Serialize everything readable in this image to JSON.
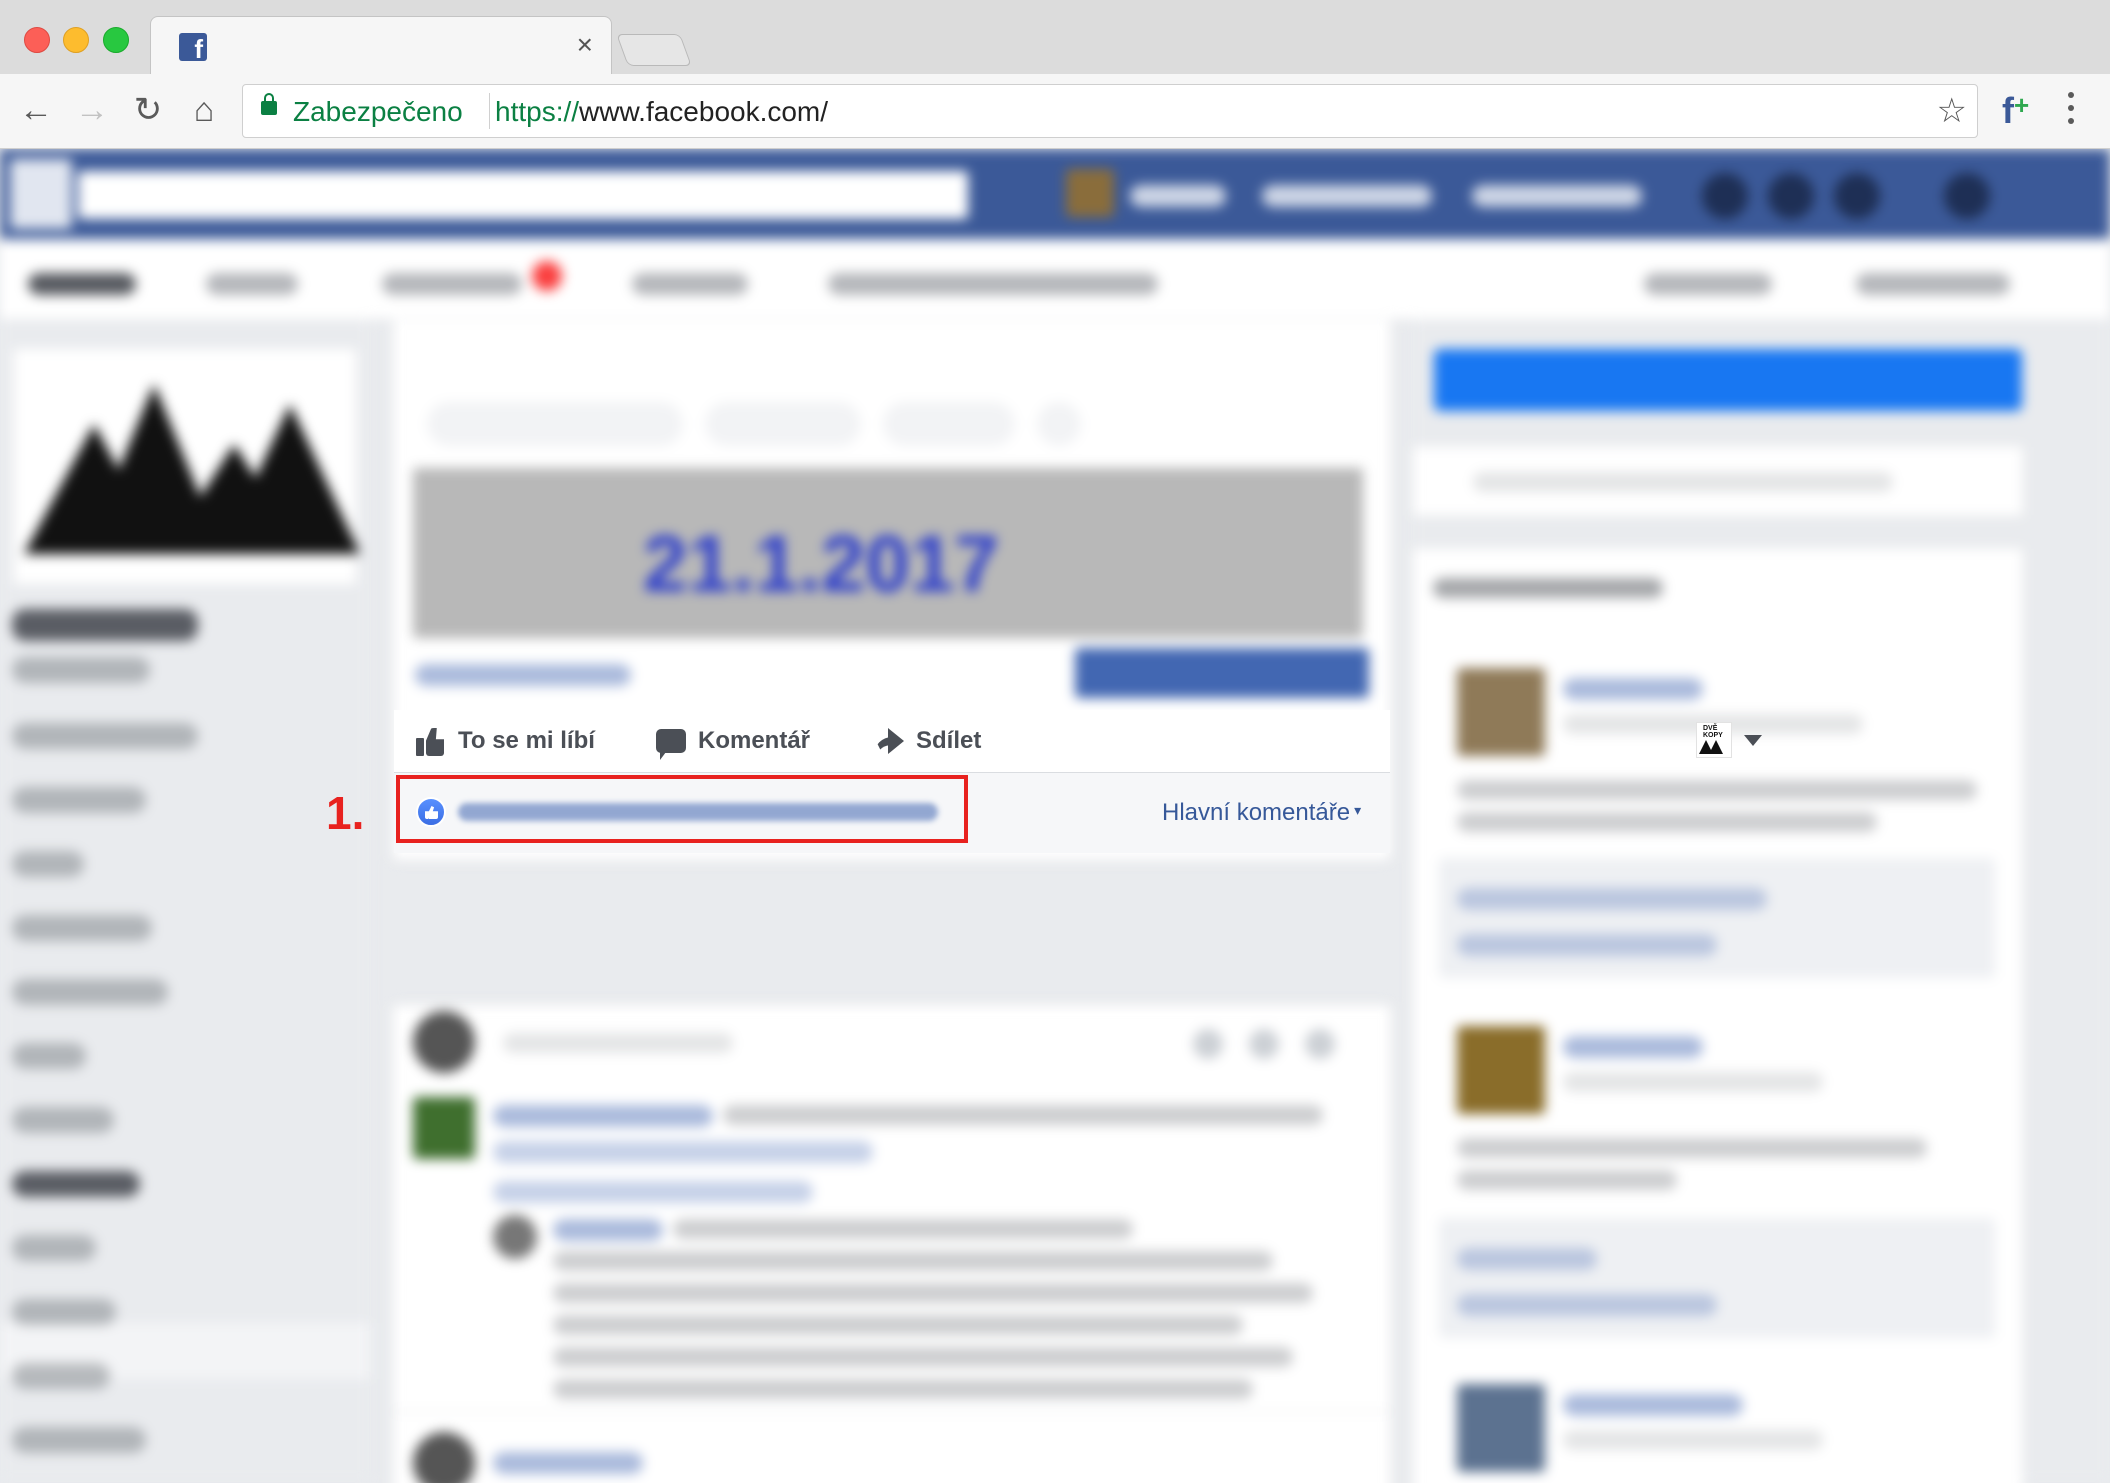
{
  "browser": {
    "tab_favicon": "f",
    "tab_close": "×",
    "security_label": "Zabezpečeno",
    "url_scheme": "https://",
    "url_rest": "www.facebook.com/",
    "icons": [
      "back-arrow-icon",
      "forward-arrow-icon",
      "reload-icon",
      "home-icon",
      "lock-icon",
      "bookmark-star-icon",
      "facebook-extension-icon",
      "menu-dots-icon"
    ]
  },
  "promo": {
    "date": "21.1.2017"
  },
  "actions": {
    "like": "To se mi líbí",
    "comment": "Komentář",
    "share": "Sdílet",
    "page_thumb_text": "DVĚ KOPY"
  },
  "reactions": {
    "sort_label": "Hlavní komentáře",
    "sort_arrow": "▾"
  },
  "annotation": {
    "step": "1.",
    "color": "#e8221f"
  },
  "colors": {
    "facebook_blue": "#3b5998",
    "link_blue": "#365899",
    "secure_green": "#0b8043"
  }
}
